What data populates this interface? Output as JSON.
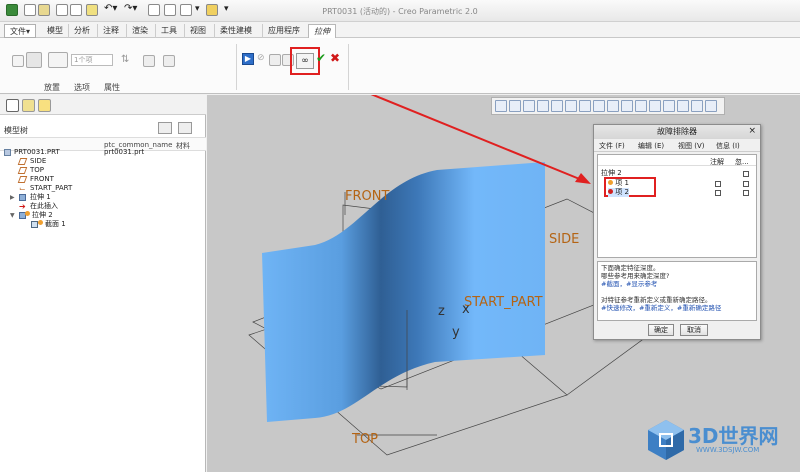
{
  "app_title": "PRT0031 (活动的) - Creo Parametric 2.0",
  "menu_tabs": [
    {
      "label": "文件",
      "dropdown": "▾"
    },
    {
      "label": "模型"
    },
    {
      "label": "分析"
    },
    {
      "label": "注释"
    },
    {
      "label": "渲染"
    },
    {
      "label": "工具"
    },
    {
      "label": "视图"
    },
    {
      "label": "柔性建模"
    },
    {
      "label": "应用程序"
    },
    {
      "label": "拉伸"
    }
  ],
  "ribbon": {
    "depth_value": "1个项",
    "group_labels": [
      "放置",
      "选项",
      "属性"
    ]
  },
  "model_tree": {
    "title": "模型树",
    "col_name": "ptc_common_name",
    "col_material": "材料",
    "items": [
      {
        "label": "PRT0031.PRT",
        "common_name": "prt0031.prt"
      },
      {
        "label": "SIDE"
      },
      {
        "label": "TOP"
      },
      {
        "label": "FRONT"
      },
      {
        "label": "START_PART"
      },
      {
        "label": "拉伸 1"
      },
      {
        "label": "在此插入"
      },
      {
        "label": "拉伸 2"
      },
      {
        "label": "截面 1"
      }
    ]
  },
  "viewport": {
    "datum_front": "FRONT",
    "datum_side": "SIDE",
    "datum_top": "TOP",
    "datum_csys": "START_PART",
    "axis_z": "z",
    "axis_x": "x",
    "axis_y": "y",
    "surface_color": "#6fb4f5"
  },
  "dialog": {
    "title": "故障排除器",
    "close": "×",
    "menu": [
      "文件 (F)",
      "编辑 (E)",
      "视图 (V)",
      "信息 (I)"
    ],
    "col_note": "注解",
    "col_ignore": "忽...",
    "root": "拉伸 2",
    "items": [
      "项 1",
      "项 2"
    ],
    "messages": [
      "下面确定特征深度。",
      "哪些参考用来确定深度?",
      "#截面，#显示参考",
      "对特征参考重新定义或重新确定路径。",
      "#快速修改，#重新定义，#重新确定路径"
    ],
    "ok_label": "确定",
    "cancel_label": "取消"
  },
  "colors": {
    "highlight_red": "#e02020",
    "ok_green": "#1a9a1a",
    "cancel_red": "#d01818",
    "datum_label": "#b46414"
  },
  "watermark": {
    "text": "3D世界网",
    "url": "WWW.3DSJW.COM"
  }
}
